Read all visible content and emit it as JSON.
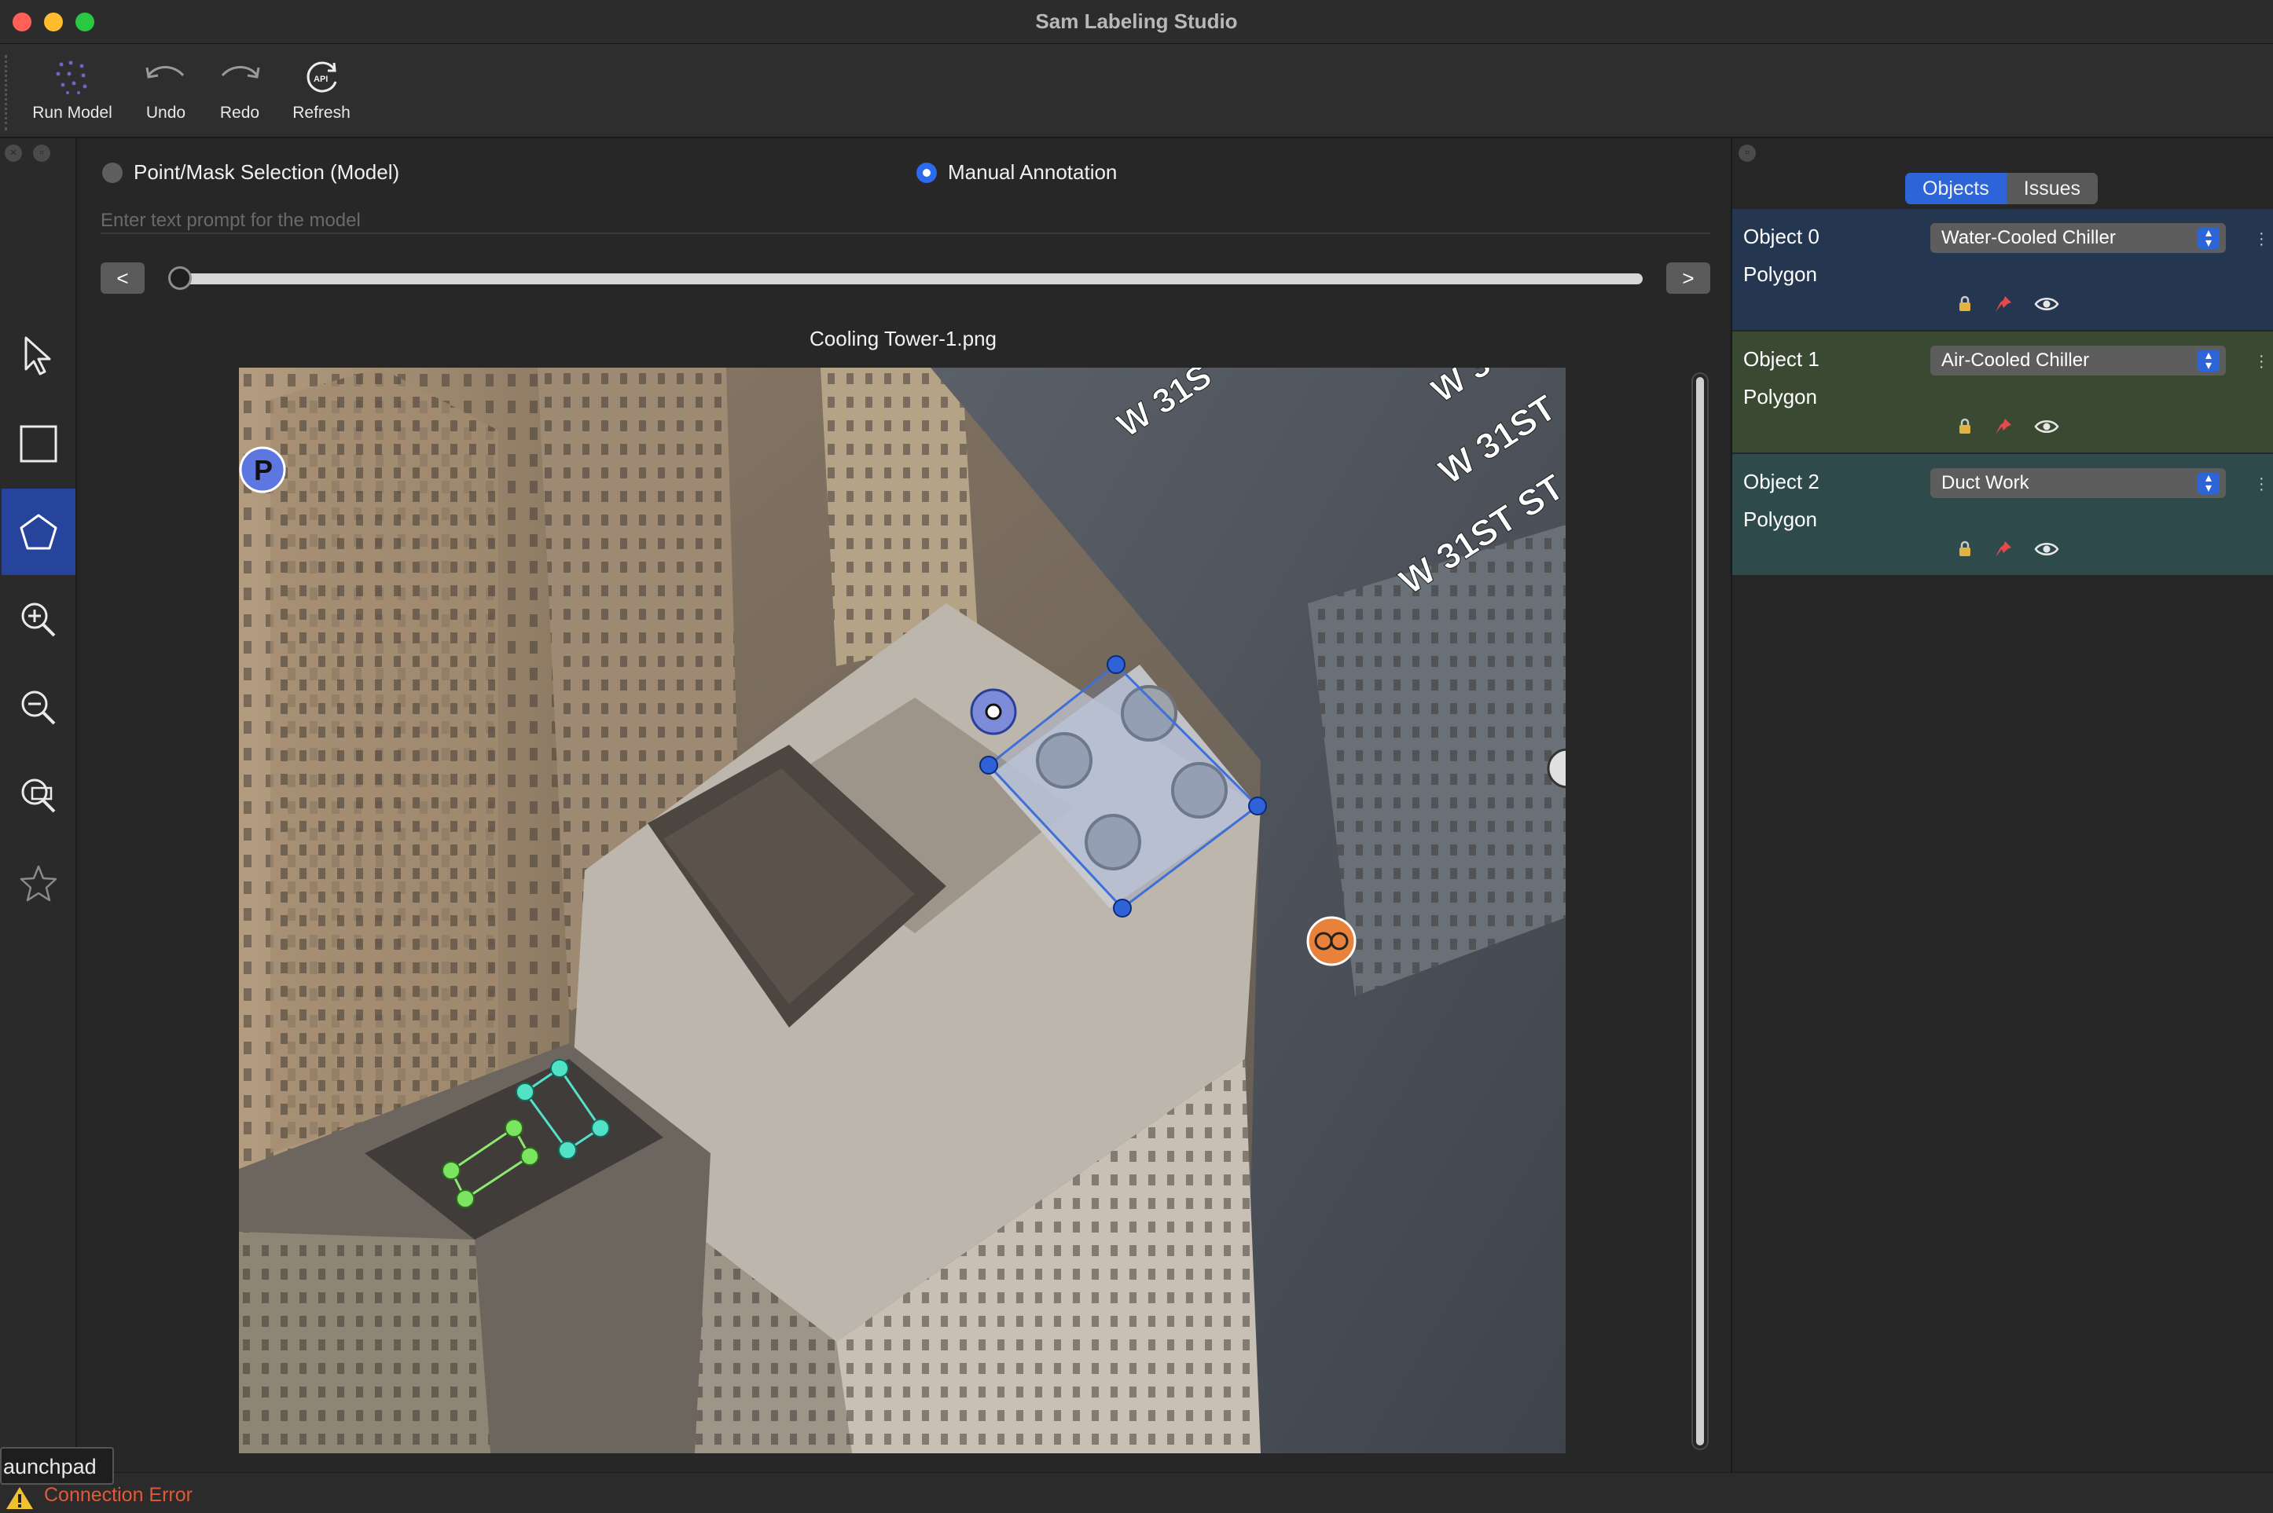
{
  "window": {
    "title": "Sam Labeling Studio"
  },
  "toolbar": {
    "run_model": "Run Model",
    "undo": "Undo",
    "redo": "Redo",
    "refresh": "Refresh"
  },
  "left_tools": [
    "pointer-tool",
    "rectangle-tool",
    "polygon-tool",
    "zoom-in-tool",
    "zoom-out-tool",
    "fit-zoom-tool",
    "favorite-tool"
  ],
  "mode": {
    "point_mask_label": "Point/Mask Selection (Model)",
    "manual_label": "Manual Annotation",
    "selected": "manual"
  },
  "prompt": {
    "placeholder": "Enter text prompt for the model"
  },
  "slider": {
    "prev": "<",
    "next": ">",
    "position": 0
  },
  "image": {
    "filename": "Cooling Tower-1.png",
    "street_labels": [
      "W 31S",
      "W 3",
      "W 31ST",
      "W 31ST ST"
    ],
    "parking_marker": "P"
  },
  "right_panel": {
    "tabs": [
      "Objects",
      "Issues"
    ],
    "selected_tab": "Objects",
    "objects": [
      {
        "name": "Object 0",
        "kind": "Polygon",
        "label": "Water-Cooled Chiller",
        "color": "#243650"
      },
      {
        "name": "Object 1",
        "kind": "Polygon",
        "label": "Air-Cooled Chiller",
        "color": "#3a4a32"
      },
      {
        "name": "Object 2",
        "kind": "Polygon",
        "label": "Duct Work",
        "color": "#2e4a4a"
      }
    ]
  },
  "status": {
    "tooltip": "aunchpad",
    "message": "Connection Error"
  }
}
